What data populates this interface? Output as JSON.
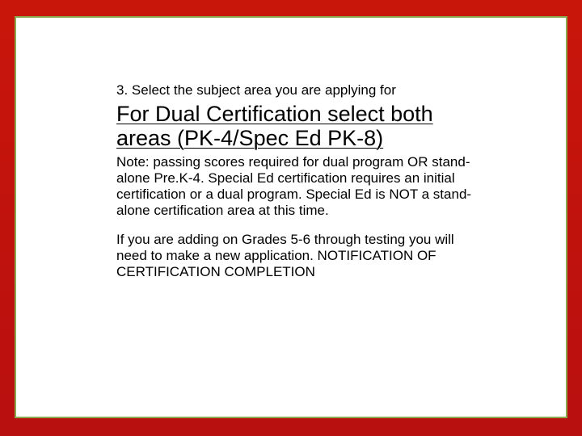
{
  "slide": {
    "step_text": "3.  Select the subject area you are applying for",
    "headline": "For Dual Certification select both areas (PK-4/Spec Ed PK-8)",
    "note": "Note: passing scores required for dual program OR stand-alone Pre.K-4.  Special Ed certification requires an initial certification or a dual program.  Special Ed is NOT a stand-alone certification area at this time.",
    "addon": "If you are adding on Grades 5-6 through testing you will need to make a new application.  NOTIFICATION OF CERTIFICATION COMPLETION"
  }
}
